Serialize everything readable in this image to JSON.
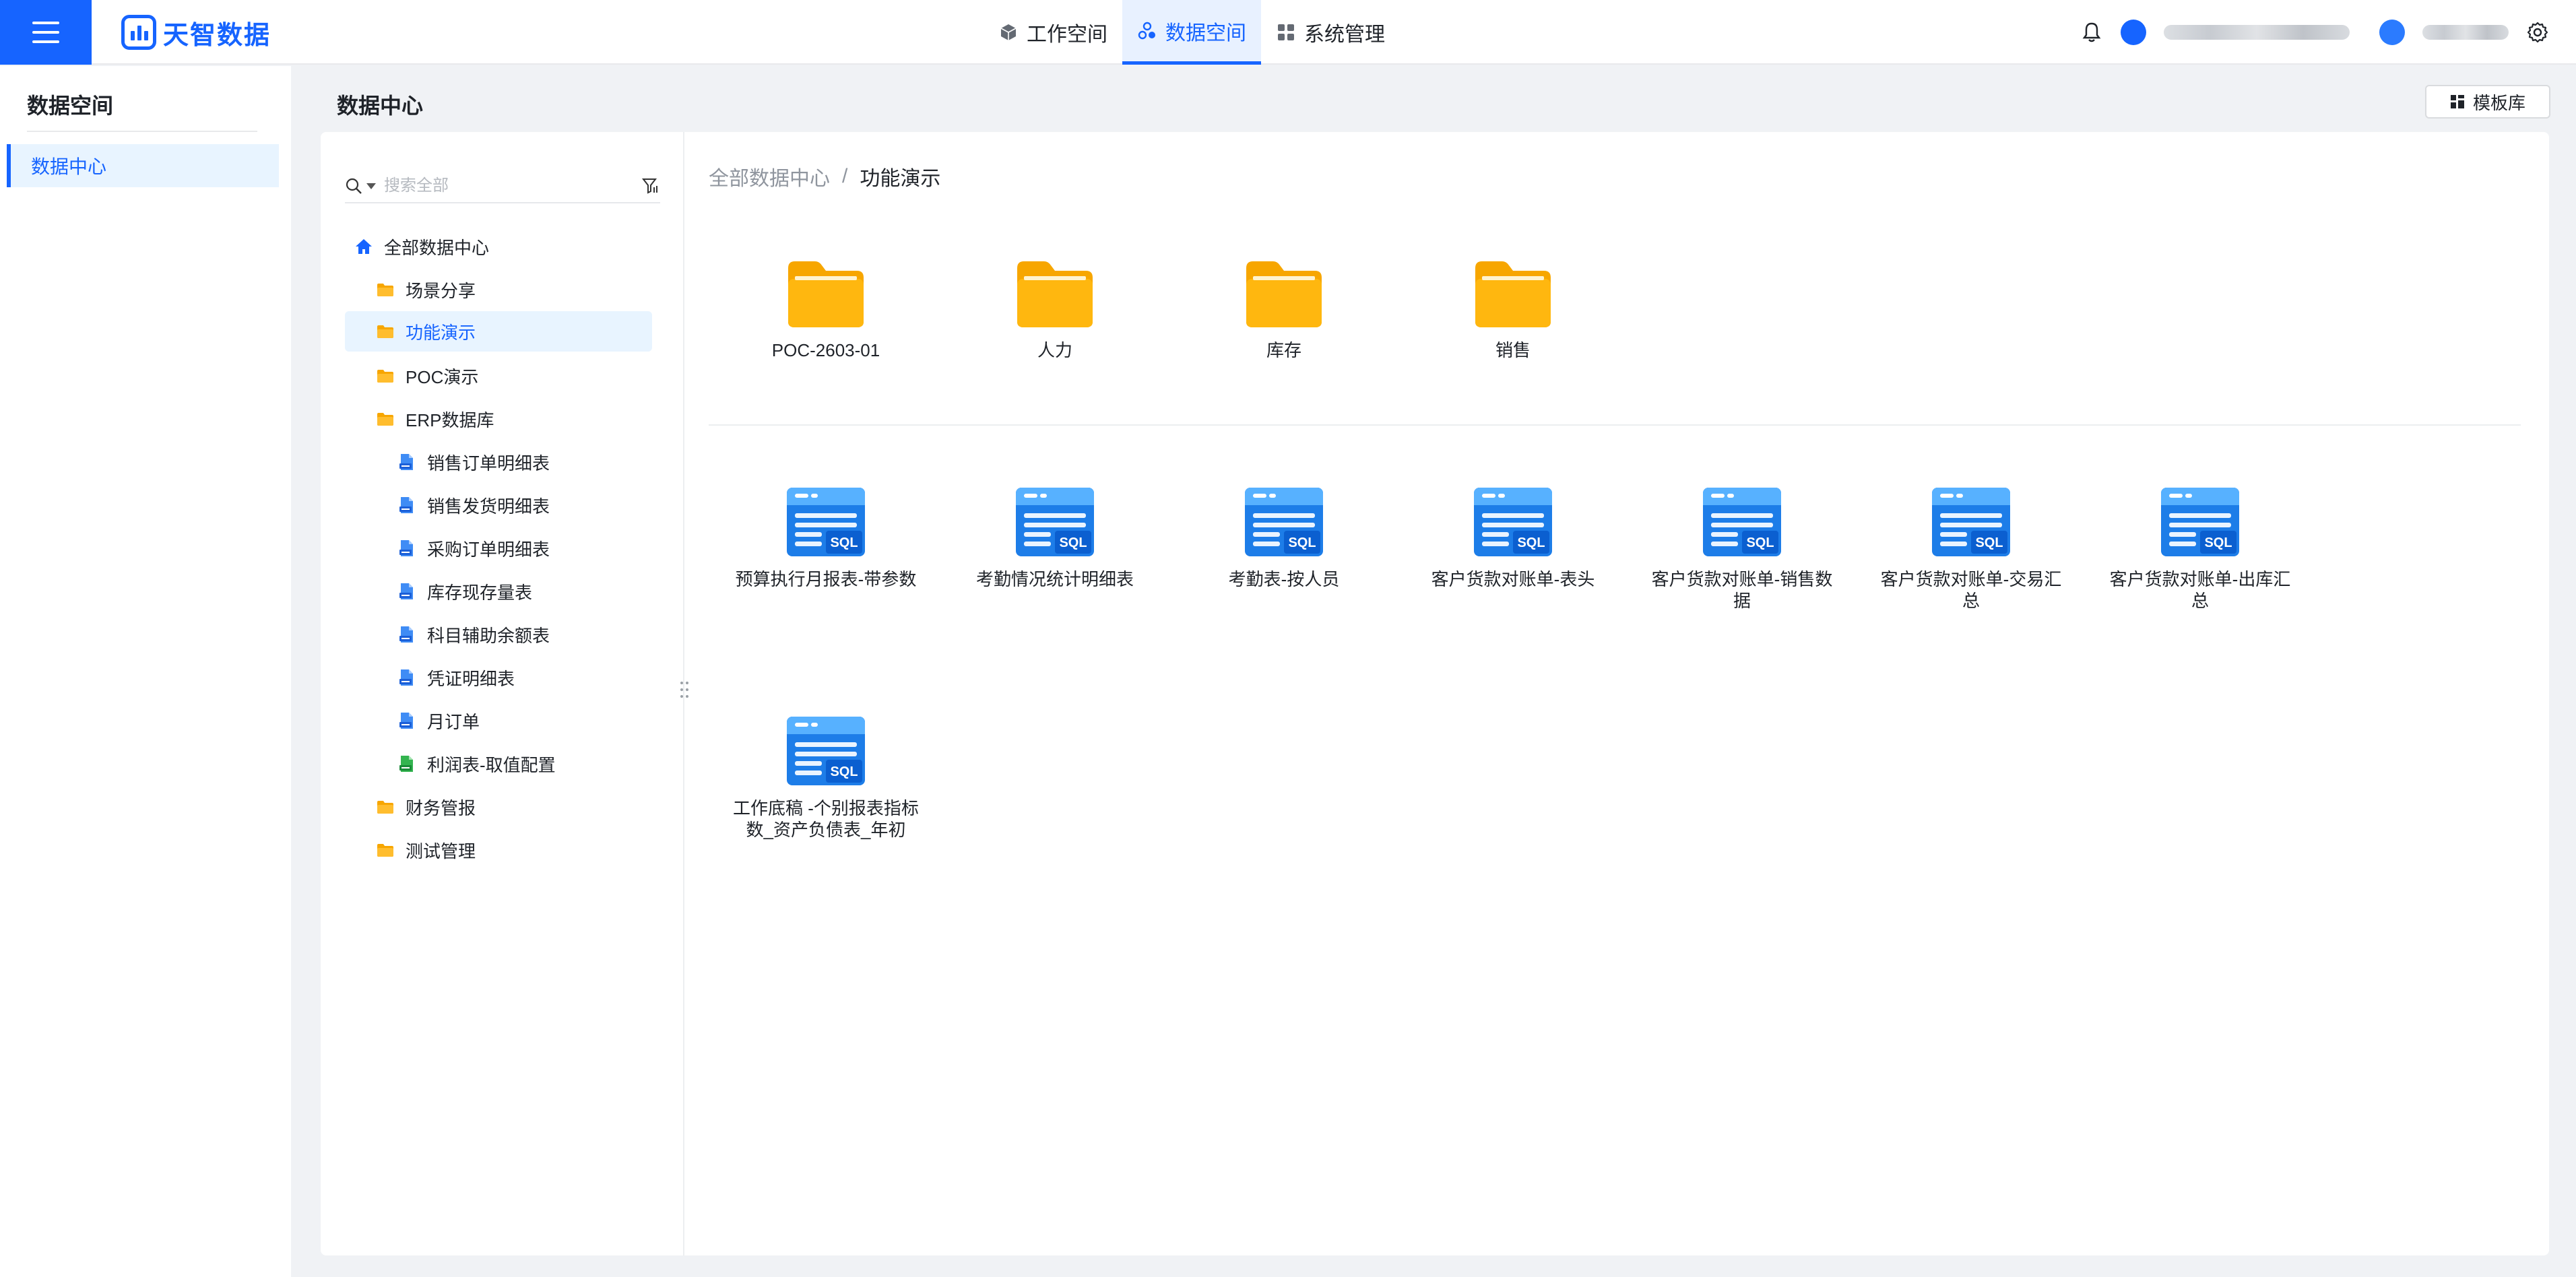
{
  "header": {
    "logo_text": "天智数据",
    "nav": [
      {
        "label": "工作空间",
        "icon": "cube-icon",
        "active": false
      },
      {
        "label": "数据空间",
        "icon": "data-cluster-icon",
        "active": true
      },
      {
        "label": "系统管理",
        "icon": "grid-apps-icon",
        "active": false
      }
    ]
  },
  "sidebar": {
    "title": "数据空间",
    "items": [
      {
        "label": "数据中心",
        "active": true
      }
    ]
  },
  "page": {
    "title": "数据中心",
    "template_button": "模板库"
  },
  "search": {
    "placeholder": "搜索全部"
  },
  "tree": {
    "root": "全部数据中心",
    "folders": [
      {
        "label": "场景分享"
      },
      {
        "label": "功能演示",
        "selected": true
      },
      {
        "label": "POC演示"
      },
      {
        "label": "ERP数据库"
      }
    ],
    "erp_children": [
      {
        "label": "销售订单明细表",
        "type": "sql"
      },
      {
        "label": "销售发货明细表",
        "type": "sql"
      },
      {
        "label": "采购订单明细表",
        "type": "sql"
      },
      {
        "label": "库存现存量表",
        "type": "sql"
      },
      {
        "label": "科目辅助余额表",
        "type": "sql"
      },
      {
        "label": "凭证明细表",
        "type": "sql"
      },
      {
        "label": "月订单",
        "type": "sql"
      },
      {
        "label": "利润表-取值配置",
        "type": "xls"
      }
    ],
    "more_folders": [
      {
        "label": "财务管报"
      },
      {
        "label": "测试管理"
      }
    ]
  },
  "breadcrumb": {
    "root": "全部数据中心",
    "separator": "/",
    "current": "功能演示"
  },
  "folders": [
    {
      "label": "POC-2603-01"
    },
    {
      "label": "人力"
    },
    {
      "label": "库存"
    },
    {
      "label": "销售"
    }
  ],
  "datasets": [
    {
      "label": "预算执行月报表-带参数"
    },
    {
      "label": "考勤情况统计明细表"
    },
    {
      "label": "考勤表-按人员"
    },
    {
      "label": "客户货款对账单-表头"
    },
    {
      "label": "客户货款对账单-销售数据"
    },
    {
      "label": "客户货款对账单-交易汇总"
    },
    {
      "label": "客户货款对账单-出库汇总"
    },
    {
      "label": "工作底稿 -个别报表指标数_资产负债表_年初"
    }
  ],
  "sql_badge": "SQL",
  "colors": {
    "accent": "#1664ff",
    "folder": "#ffb300",
    "sql_tile": "#2a8ff0"
  }
}
